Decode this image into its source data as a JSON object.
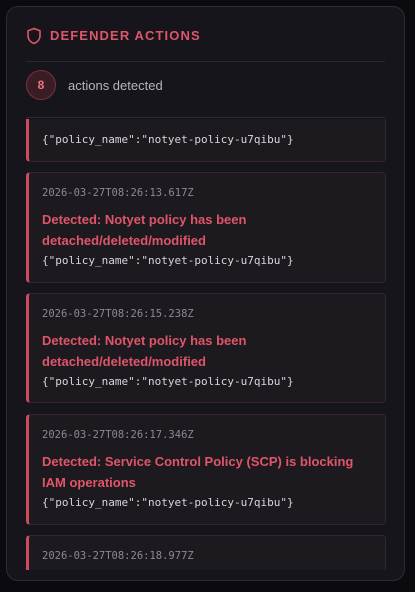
{
  "panel": {
    "title": "DEFENDER ACTIONS",
    "icon": "shield-icon",
    "accent_color": "#e05569"
  },
  "summary": {
    "count": "8",
    "label": "actions detected"
  },
  "actions": [
    {
      "timestamp": "",
      "message": "",
      "details": "{\"policy_name\":\"notyet-policy-u7qibu\"}"
    },
    {
      "timestamp": "2026-03-27T08:26:13.617Z",
      "message": "Detected: Notyet policy has been detached/deleted/modified",
      "details": "{\"policy_name\":\"notyet-policy-u7qibu\"}"
    },
    {
      "timestamp": "2026-03-27T08:26:15.238Z",
      "message": "Detected: Notyet policy has been detached/deleted/modified",
      "details": "{\"policy_name\":\"notyet-policy-u7qibu\"}"
    },
    {
      "timestamp": "2026-03-27T08:26:17.346Z",
      "message": "Detected: Service Control Policy (SCP) is blocking IAM operations",
      "details": "{\"policy_name\":\"notyet-policy-u7qibu\"}"
    },
    {
      "timestamp": "2026-03-27T08:26:18.977Z",
      "message": "",
      "details": ""
    }
  ]
}
